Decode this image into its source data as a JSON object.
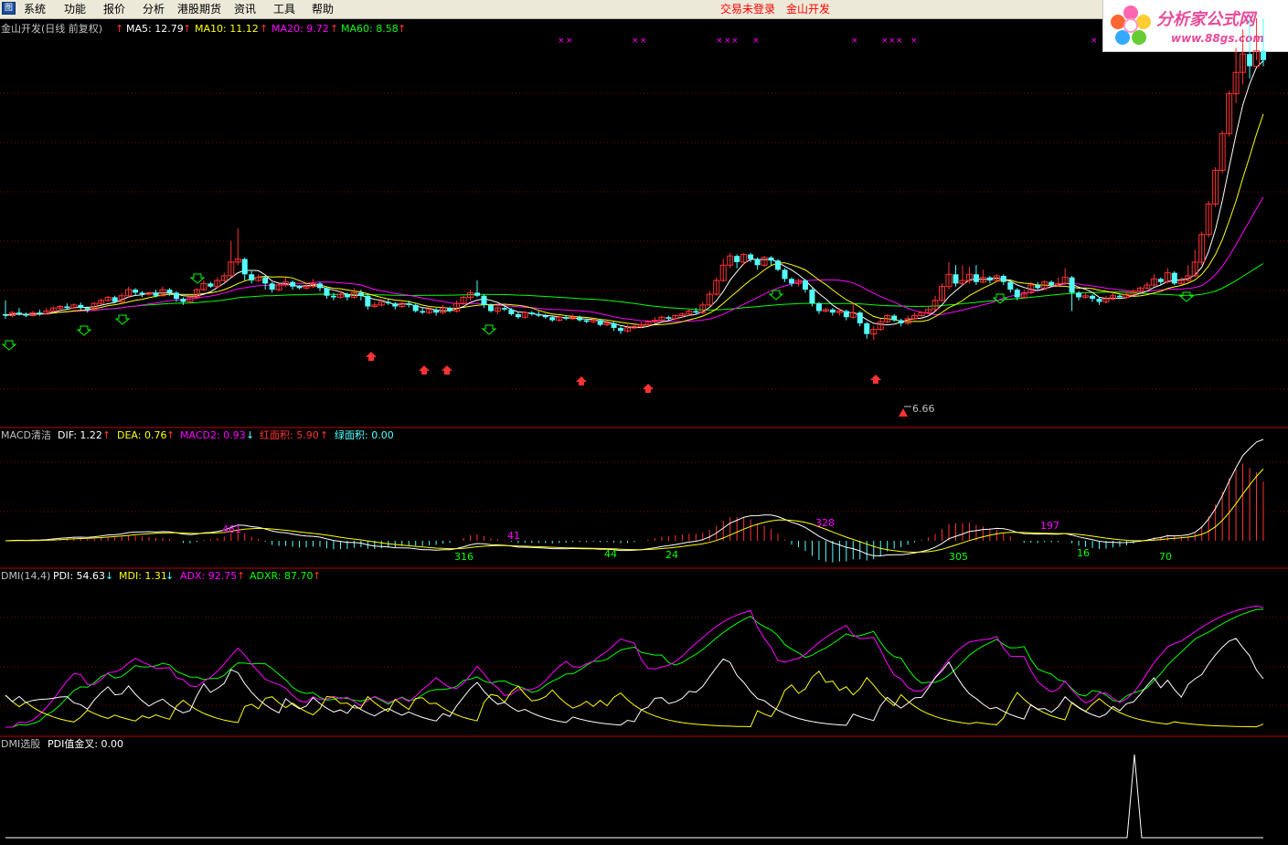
{
  "app_icon": "chart-app-icon",
  "menu": [
    "系统",
    "功能",
    "报价",
    "分析",
    "港股期货",
    "资讯",
    "工具",
    "帮助"
  ],
  "status": {
    "trade_login": "交易未登录",
    "company": "金山开发"
  },
  "logo": {
    "main": "分析家公式网",
    "url": "www.88gs.com"
  },
  "colors": {
    "up": "#ff3232",
    "down": "#54ffff",
    "ma5": "#ffffff",
    "ma10": "#ffff00",
    "ma20": "#ff00ff",
    "ma60": "#00ff00",
    "divider": "#c00000",
    "grid": "#800000"
  },
  "price_panel": {
    "title": "金山开发(日线 前复权)",
    "ma5_label": "MA5: 12.79",
    "ma10_label": "MA10: 11.12",
    "ma20_label": "MA20: 9.72",
    "ma60_label": "MA60: 8.58",
    "low_label": "6.66"
  },
  "macd_panel": {
    "title": "MACD清洁",
    "dif_label": "DIF: 1.22",
    "dea_label": "DEA: 0.76",
    "macd2_label": "MACD2: 0.93",
    "red_area_label": "红面积: 5.90",
    "green_area_label": "绿面积: 0.00",
    "annotations": [
      "461",
      "41",
      "316",
      "44",
      "24",
      "328",
      "305",
      "197",
      "16",
      "70"
    ]
  },
  "dmi_panel": {
    "title": "DMI(14,4)",
    "pdi_label": "PDI: 54.63",
    "mdi_label": "MDI: 1.31",
    "adx_label": "ADX: 92.75",
    "adxr_label": "ADXR: 87.70"
  },
  "dmi_select_panel": {
    "title": "DMI选股",
    "pdi_cross_label": "PDI值金叉: 0.00"
  },
  "chart_data": {
    "type": "candlestick",
    "stock": "金山开发",
    "timeframe": "日线 前复权",
    "candles": [
      {
        "o": 7.5,
        "c": 7.45,
        "h": 7.95,
        "l": 7.35
      },
      {
        "o": 7.45,
        "c": 7.55,
        "h": 7.6,
        "l": 7.4
      },
      {
        "o": 7.55,
        "c": 7.5,
        "h": 7.7,
        "l": 7.45
      },
      {
        "o": 7.5,
        "c": 7.45,
        "h": 7.55,
        "l": 7.4
      },
      {
        "o": 7.45,
        "c": 7.55,
        "h": 7.6,
        "l": 7.42
      },
      {
        "o": 7.55,
        "c": 7.5,
        "h": 7.65,
        "l": 7.45
      },
      {
        "o": 7.5,
        "c": 7.6,
        "h": 7.7,
        "l": 7.48
      },
      {
        "o": 7.6,
        "c": 7.7,
        "h": 7.75,
        "l": 7.55
      },
      {
        "o": 7.7,
        "c": 7.75,
        "h": 7.8,
        "l": 7.62
      },
      {
        "o": 7.75,
        "c": 7.7,
        "h": 7.85,
        "l": 7.65
      },
      {
        "o": 7.7,
        "c": 7.8,
        "h": 7.85,
        "l": 7.68
      },
      {
        "o": 7.8,
        "c": 7.7,
        "h": 7.88,
        "l": 7.62
      },
      {
        "o": 7.7,
        "c": 7.65,
        "h": 7.75,
        "l": 7.55
      },
      {
        "o": 7.65,
        "c": 7.85,
        "h": 7.9,
        "l": 7.6
      },
      {
        "o": 7.85,
        "c": 7.95,
        "h": 8.0,
        "l": 7.8
      },
      {
        "o": 7.95,
        "c": 8.05,
        "h": 8.1,
        "l": 7.9
      },
      {
        "o": 8.05,
        "c": 7.9,
        "h": 8.1,
        "l": 7.85
      },
      {
        "o": 7.9,
        "c": 8.1,
        "h": 8.2,
        "l": 7.85
      },
      {
        "o": 8.1,
        "c": 8.3,
        "h": 8.4,
        "l": 8.05
      },
      {
        "o": 8.3,
        "c": 8.2,
        "h": 8.35,
        "l": 8.1
      },
      {
        "o": 8.2,
        "c": 8.15,
        "h": 8.25,
        "l": 8.05
      },
      {
        "o": 8.15,
        "c": 8.2,
        "h": 8.22,
        "l": 8.1
      },
      {
        "o": 8.2,
        "c": 8.1,
        "h": 8.3,
        "l": 8.05
      },
      {
        "o": 8.1,
        "c": 8.3,
        "h": 8.4,
        "l": 8.08
      },
      {
        "o": 8.3,
        "c": 8.2,
        "h": 8.35,
        "l": 8.1
      },
      {
        "o": 8.2,
        "c": 8.0,
        "h": 8.25,
        "l": 7.9
      },
      {
        "o": 8.0,
        "c": 7.9,
        "h": 8.05,
        "l": 7.8
      },
      {
        "o": 7.9,
        "c": 8.05,
        "h": 8.1,
        "l": 7.85
      },
      {
        "o": 8.05,
        "c": 8.3,
        "h": 8.35,
        "l": 8.0
      },
      {
        "o": 8.3,
        "c": 8.5,
        "h": 8.6,
        "l": 8.25
      },
      {
        "o": 8.5,
        "c": 8.4,
        "h": 8.55,
        "l": 8.35
      },
      {
        "o": 8.4,
        "c": 8.6,
        "h": 8.7,
        "l": 8.35
      },
      {
        "o": 8.6,
        "c": 8.75,
        "h": 8.85,
        "l": 8.55
      },
      {
        "o": 8.75,
        "c": 9.2,
        "h": 9.9,
        "l": 8.7
      },
      {
        "o": 9.2,
        "c": 9.3,
        "h": 10.3,
        "l": 9.1
      },
      {
        "o": 9.3,
        "c": 8.8,
        "h": 9.35,
        "l": 8.6
      },
      {
        "o": 8.8,
        "c": 8.6,
        "h": 8.9,
        "l": 8.5
      },
      {
        "o": 8.6,
        "c": 8.7,
        "h": 8.8,
        "l": 8.55
      },
      {
        "o": 8.7,
        "c": 8.5,
        "h": 8.75,
        "l": 8.3
      },
      {
        "o": 8.5,
        "c": 8.3,
        "h": 8.55,
        "l": 8.2
      },
      {
        "o": 8.3,
        "c": 8.45,
        "h": 8.5,
        "l": 8.25
      },
      {
        "o": 8.45,
        "c": 8.55,
        "h": 8.7,
        "l": 8.4
      },
      {
        "o": 8.55,
        "c": 8.4,
        "h": 8.6,
        "l": 8.3
      },
      {
        "o": 8.4,
        "c": 8.35,
        "h": 8.45,
        "l": 8.3
      },
      {
        "o": 8.35,
        "c": 8.4,
        "h": 8.5,
        "l": 8.3
      },
      {
        "o": 8.4,
        "c": 8.5,
        "h": 8.65,
        "l": 8.35
      },
      {
        "o": 8.5,
        "c": 8.35,
        "h": 8.55,
        "l": 8.25
      },
      {
        "o": 8.35,
        "c": 8.1,
        "h": 8.4,
        "l": 8.0
      },
      {
        "o": 8.1,
        "c": 8.05,
        "h": 8.2,
        "l": 7.95
      },
      {
        "o": 8.05,
        "c": 8.15,
        "h": 8.25,
        "l": 8.0
      },
      {
        "o": 8.15,
        "c": 8.05,
        "h": 8.2,
        "l": 7.95
      },
      {
        "o": 8.05,
        "c": 8.2,
        "h": 8.35,
        "l": 8.0
      },
      {
        "o": 8.2,
        "c": 8.1,
        "h": 8.3,
        "l": 7.95
      },
      {
        "o": 8.1,
        "c": 7.75,
        "h": 8.15,
        "l": 7.65
      },
      {
        "o": 7.75,
        "c": 7.8,
        "h": 7.9,
        "l": 7.7
      },
      {
        "o": 7.8,
        "c": 7.9,
        "h": 7.95,
        "l": 7.75
      },
      {
        "o": 7.9,
        "c": 7.85,
        "h": 8.0,
        "l": 7.8
      },
      {
        "o": 7.85,
        "c": 7.75,
        "h": 7.9,
        "l": 7.65
      },
      {
        "o": 7.75,
        "c": 7.85,
        "h": 7.9,
        "l": 7.7
      },
      {
        "o": 7.85,
        "c": 7.8,
        "h": 7.95,
        "l": 7.72
      },
      {
        "o": 7.8,
        "c": 7.6,
        "h": 7.85,
        "l": 7.55
      },
      {
        "o": 7.6,
        "c": 7.55,
        "h": 7.7,
        "l": 7.5
      },
      {
        "o": 7.55,
        "c": 7.65,
        "h": 7.7,
        "l": 7.5
      },
      {
        "o": 7.65,
        "c": 7.55,
        "h": 7.7,
        "l": 7.45
      },
      {
        "o": 7.55,
        "c": 7.7,
        "h": 7.8,
        "l": 7.5
      },
      {
        "o": 7.7,
        "c": 7.6,
        "h": 7.75,
        "l": 7.55
      },
      {
        "o": 7.6,
        "c": 7.85,
        "h": 7.95,
        "l": 7.55
      },
      {
        "o": 7.85,
        "c": 8.05,
        "h": 8.1,
        "l": 7.8
      },
      {
        "o": 8.05,
        "c": 8.2,
        "h": 8.3,
        "l": 7.95
      },
      {
        "o": 8.2,
        "c": 8.1,
        "h": 8.6,
        "l": 8.05
      },
      {
        "o": 8.1,
        "c": 7.8,
        "h": 8.15,
        "l": 7.7
      },
      {
        "o": 7.8,
        "c": 7.6,
        "h": 7.85,
        "l": 7.55
      },
      {
        "o": 7.6,
        "c": 7.7,
        "h": 7.75,
        "l": 7.5
      },
      {
        "o": 7.7,
        "c": 7.65,
        "h": 7.8,
        "l": 7.6
      },
      {
        "o": 7.65,
        "c": 7.5,
        "h": 7.7,
        "l": 7.45
      },
      {
        "o": 7.5,
        "c": 7.4,
        "h": 7.55,
        "l": 7.35
      },
      {
        "o": 7.4,
        "c": 7.55,
        "h": 7.6,
        "l": 7.35
      },
      {
        "o": 7.55,
        "c": 7.5,
        "h": 7.6,
        "l": 7.45
      },
      {
        "o": 7.5,
        "c": 7.45,
        "h": 7.6,
        "l": 7.4
      },
      {
        "o": 7.45,
        "c": 7.4,
        "h": 7.5,
        "l": 7.35
      },
      {
        "o": 7.4,
        "c": 7.3,
        "h": 7.45,
        "l": 7.25
      },
      {
        "o": 7.3,
        "c": 7.4,
        "h": 7.45,
        "l": 7.25
      },
      {
        "o": 7.4,
        "c": 7.35,
        "h": 7.45,
        "l": 7.3
      },
      {
        "o": 7.35,
        "c": 7.4,
        "h": 7.5,
        "l": 7.3
      },
      {
        "o": 7.4,
        "c": 7.3,
        "h": 7.45,
        "l": 7.25
      },
      {
        "o": 7.3,
        "c": 7.25,
        "h": 7.35,
        "l": 7.2
      },
      {
        "o": 7.25,
        "c": 7.3,
        "h": 7.35,
        "l": 7.2
      },
      {
        "o": 7.3,
        "c": 7.15,
        "h": 7.35,
        "l": 7.1
      },
      {
        "o": 7.15,
        "c": 7.2,
        "h": 7.3,
        "l": 7.1
      },
      {
        "o": 7.2,
        "c": 7.05,
        "h": 7.25,
        "l": 6.95
      },
      {
        "o": 7.05,
        "c": 6.95,
        "h": 7.1,
        "l": 6.85
      },
      {
        "o": 6.95,
        "c": 7.05,
        "h": 7.15,
        "l": 6.9
      },
      {
        "o": 7.05,
        "c": 7.1,
        "h": 7.15,
        "l": 7.0
      },
      {
        "o": 7.1,
        "c": 7.15,
        "h": 7.25,
        "l": 7.05
      },
      {
        "o": 7.15,
        "c": 7.25,
        "h": 7.3,
        "l": 7.1
      },
      {
        "o": 7.25,
        "c": 7.3,
        "h": 7.4,
        "l": 7.2
      },
      {
        "o": 7.3,
        "c": 7.4,
        "h": 7.45,
        "l": 7.25
      },
      {
        "o": 7.4,
        "c": 7.35,
        "h": 7.45,
        "l": 7.3
      },
      {
        "o": 7.35,
        "c": 7.45,
        "h": 7.5,
        "l": 7.3
      },
      {
        "o": 7.45,
        "c": 7.5,
        "h": 7.55,
        "l": 7.4
      },
      {
        "o": 7.5,
        "c": 7.6,
        "h": 7.65,
        "l": 7.45
      },
      {
        "o": 7.6,
        "c": 7.55,
        "h": 7.7,
        "l": 7.5
      },
      {
        "o": 7.55,
        "c": 7.8,
        "h": 7.9,
        "l": 7.5
      },
      {
        "o": 7.8,
        "c": 8.15,
        "h": 8.25,
        "l": 7.75
      },
      {
        "o": 8.15,
        "c": 8.6,
        "h": 8.7,
        "l": 8.1
      },
      {
        "o": 8.6,
        "c": 9.1,
        "h": 9.3,
        "l": 8.55
      },
      {
        "o": 9.1,
        "c": 9.4,
        "h": 9.5,
        "l": 9.0
      },
      {
        "o": 9.4,
        "c": 9.2,
        "h": 9.45,
        "l": 9.0
      },
      {
        "o": 9.2,
        "c": 9.45,
        "h": 9.5,
        "l": 9.1
      },
      {
        "o": 9.45,
        "c": 9.3,
        "h": 9.5,
        "l": 9.2
      },
      {
        "o": 9.3,
        "c": 9.1,
        "h": 9.35,
        "l": 8.95
      },
      {
        "o": 9.1,
        "c": 9.35,
        "h": 9.4,
        "l": 9.05
      },
      {
        "o": 9.35,
        "c": 9.25,
        "h": 9.4,
        "l": 9.1
      },
      {
        "o": 9.25,
        "c": 8.95,
        "h": 9.3,
        "l": 8.9
      },
      {
        "o": 8.95,
        "c": 8.65,
        "h": 9.0,
        "l": 8.55
      },
      {
        "o": 8.65,
        "c": 8.5,
        "h": 8.7,
        "l": 8.4
      },
      {
        "o": 8.5,
        "c": 8.6,
        "h": 8.65,
        "l": 8.4
      },
      {
        "o": 8.6,
        "c": 8.3,
        "h": 8.65,
        "l": 8.2
      },
      {
        "o": 8.3,
        "c": 7.85,
        "h": 8.35,
        "l": 7.75
      },
      {
        "o": 7.85,
        "c": 7.6,
        "h": 7.9,
        "l": 7.5
      },
      {
        "o": 7.6,
        "c": 7.65,
        "h": 7.7,
        "l": 7.55
      },
      {
        "o": 7.65,
        "c": 7.55,
        "h": 7.7,
        "l": 7.45
      },
      {
        "o": 7.55,
        "c": 7.6,
        "h": 7.7,
        "l": 7.45
      },
      {
        "o": 7.6,
        "c": 7.4,
        "h": 7.65,
        "l": 7.3
      },
      {
        "o": 7.4,
        "c": 7.55,
        "h": 7.9,
        "l": 7.35
      },
      {
        "o": 7.55,
        "c": 7.2,
        "h": 7.6,
        "l": 7.1
      },
      {
        "o": 7.2,
        "c": 6.85,
        "h": 7.25,
        "l": 6.7
      },
      {
        "o": 6.85,
        "c": 7.0,
        "h": 7.1,
        "l": 6.66
      },
      {
        "o": 7.0,
        "c": 7.25,
        "h": 7.35,
        "l": 6.95
      },
      {
        "o": 7.25,
        "c": 7.45,
        "h": 7.5,
        "l": 7.2
      },
      {
        "o": 7.45,
        "c": 7.3,
        "h": 7.5,
        "l": 7.25
      },
      {
        "o": 7.3,
        "c": 7.2,
        "h": 7.35,
        "l": 7.1
      },
      {
        "o": 7.2,
        "c": 7.35,
        "h": 7.45,
        "l": 7.15
      },
      {
        "o": 7.35,
        "c": 7.45,
        "h": 7.55,
        "l": 7.3
      },
      {
        "o": 7.45,
        "c": 7.55,
        "h": 7.6,
        "l": 7.4
      },
      {
        "o": 7.55,
        "c": 7.65,
        "h": 7.75,
        "l": 7.5
      },
      {
        "o": 7.65,
        "c": 7.95,
        "h": 8.1,
        "l": 7.6
      },
      {
        "o": 7.95,
        "c": 8.4,
        "h": 8.5,
        "l": 7.9
      },
      {
        "o": 8.4,
        "c": 8.8,
        "h": 9.2,
        "l": 8.3
      },
      {
        "o": 8.8,
        "c": 8.5,
        "h": 9.1,
        "l": 8.4
      },
      {
        "o": 8.5,
        "c": 8.6,
        "h": 9.1,
        "l": 8.45
      },
      {
        "o": 8.6,
        "c": 8.8,
        "h": 9.05,
        "l": 8.5
      },
      {
        "o": 8.8,
        "c": 8.55,
        "h": 9.1,
        "l": 8.45
      },
      {
        "o": 8.55,
        "c": 8.7,
        "h": 8.95,
        "l": 8.5
      },
      {
        "o": 8.7,
        "c": 8.6,
        "h": 8.75,
        "l": 8.5
      },
      {
        "o": 8.6,
        "c": 8.75,
        "h": 8.8,
        "l": 8.55
      },
      {
        "o": 8.75,
        "c": 8.55,
        "h": 8.8,
        "l": 8.45
      },
      {
        "o": 8.55,
        "c": 8.3,
        "h": 8.6,
        "l": 8.2
      },
      {
        "o": 8.3,
        "c": 8.05,
        "h": 8.35,
        "l": 7.95
      },
      {
        "o": 8.05,
        "c": 8.2,
        "h": 8.3,
        "l": 8.0
      },
      {
        "o": 8.2,
        "c": 8.45,
        "h": 8.55,
        "l": 8.15
      },
      {
        "o": 8.45,
        "c": 8.35,
        "h": 8.55,
        "l": 8.3
      },
      {
        "o": 8.35,
        "c": 8.55,
        "h": 8.6,
        "l": 8.3
      },
      {
        "o": 8.55,
        "c": 8.45,
        "h": 8.6,
        "l": 8.4
      },
      {
        "o": 8.45,
        "c": 8.5,
        "h": 8.7,
        "l": 8.4
      },
      {
        "o": 8.5,
        "c": 8.7,
        "h": 9.0,
        "l": 8.45
      },
      {
        "o": 8.7,
        "c": 8.2,
        "h": 8.75,
        "l": 7.6
      },
      {
        "o": 8.2,
        "c": 8.05,
        "h": 8.25,
        "l": 7.95
      },
      {
        "o": 8.05,
        "c": 8.1,
        "h": 8.2,
        "l": 8.0
      },
      {
        "o": 8.1,
        "c": 8.0,
        "h": 8.15,
        "l": 7.9
      },
      {
        "o": 8.0,
        "c": 7.9,
        "h": 8.05,
        "l": 7.8
      },
      {
        "o": 7.9,
        "c": 8.0,
        "h": 8.1,
        "l": 7.85
      },
      {
        "o": 8.0,
        "c": 8.1,
        "h": 8.2,
        "l": 7.95
      },
      {
        "o": 8.1,
        "c": 8.05,
        "h": 8.15,
        "l": 8.0
      },
      {
        "o": 8.05,
        "c": 8.15,
        "h": 8.25,
        "l": 8.0
      },
      {
        "o": 8.15,
        "c": 8.25,
        "h": 8.3,
        "l": 8.1
      },
      {
        "o": 8.25,
        "c": 8.35,
        "h": 8.4,
        "l": 8.2
      },
      {
        "o": 8.35,
        "c": 8.45,
        "h": 8.55,
        "l": 8.3
      },
      {
        "o": 8.45,
        "c": 8.65,
        "h": 8.8,
        "l": 8.4
      },
      {
        "o": 8.65,
        "c": 8.55,
        "h": 8.7,
        "l": 8.45
      },
      {
        "o": 8.55,
        "c": 8.85,
        "h": 9.0,
        "l": 8.5
      },
      {
        "o": 8.85,
        "c": 8.5,
        "h": 8.9,
        "l": 8.45
      },
      {
        "o": 8.5,
        "c": 8.6,
        "h": 8.7,
        "l": 8.45
      },
      {
        "o": 8.6,
        "c": 8.75,
        "h": 9.1,
        "l": 8.55
      },
      {
        "o": 8.75,
        "c": 9.2,
        "h": 9.6,
        "l": 8.7
      },
      {
        "o": 9.2,
        "c": 10.1,
        "h": 10.2,
        "l": 9.1
      },
      {
        "o": 10.1,
        "c": 11.1,
        "h": 11.2,
        "l": 10.0
      },
      {
        "o": 11.1,
        "c": 12.2,
        "h": 12.3,
        "l": 11.0
      },
      {
        "o": 12.2,
        "c": 13.4,
        "h": 13.5,
        "l": 12.1
      },
      {
        "o": 13.4,
        "c": 14.7,
        "h": 14.8,
        "l": 13.3
      },
      {
        "o": 14.7,
        "c": 15.4,
        "h": 16.2,
        "l": 14.4
      },
      {
        "o": 15.4,
        "c": 16.0,
        "h": 16.8,
        "l": 15.0
      },
      {
        "o": 16.0,
        "c": 15.6,
        "h": 17.5,
        "l": 15.2
      },
      {
        "o": 15.6,
        "c": 16.1,
        "h": 17.3,
        "l": 15.8
      },
      {
        "o": 16.1,
        "c": 15.8,
        "h": 17.5,
        "l": 15.6
      }
    ]
  }
}
